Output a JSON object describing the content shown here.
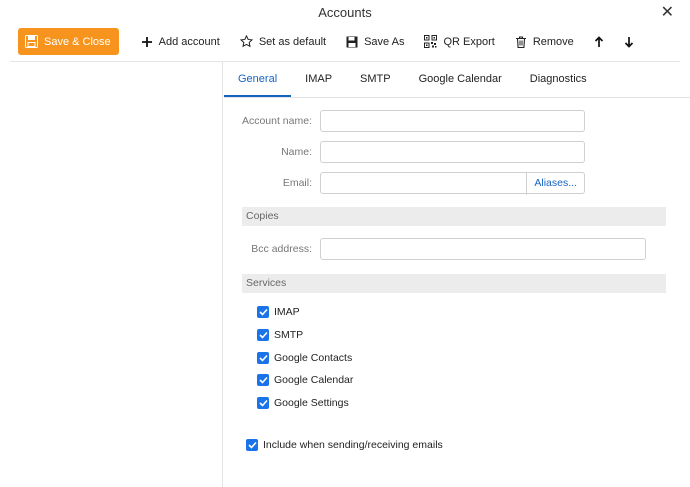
{
  "window": {
    "title": "Accounts"
  },
  "toolbar": {
    "save_close": "Save & Close",
    "add_account": "Add account",
    "set_default": "Set as default",
    "save_as": "Save As",
    "qr_export": "QR Export",
    "remove": "Remove"
  },
  "tabs": [
    {
      "label": "General",
      "active": true
    },
    {
      "label": "IMAP"
    },
    {
      "label": "SMTP"
    },
    {
      "label": "Google Calendar"
    },
    {
      "label": "Diagnostics"
    }
  ],
  "form": {
    "account_name_label": "Account name:",
    "account_name_value": "",
    "name_label": "Name:",
    "name_value": "",
    "email_label": "Email:",
    "email_value": "",
    "aliases_button": "Aliases...",
    "copies_header": "Copies",
    "bcc_label": "Bcc address:",
    "bcc_value": "",
    "services_header": "Services"
  },
  "services": [
    {
      "label": "IMAP",
      "checked": true
    },
    {
      "label": "SMTP",
      "checked": true
    },
    {
      "label": "Google Contacts",
      "checked": true
    },
    {
      "label": "Google Calendar",
      "checked": true
    },
    {
      "label": "Google Settings",
      "checked": true
    }
  ],
  "include_sending": {
    "label": "Include when sending/receiving emails",
    "checked": true
  },
  "colors": {
    "accent": "#1565c0",
    "primary_button": "#f7941d",
    "checkbox": "#1a73e8"
  }
}
